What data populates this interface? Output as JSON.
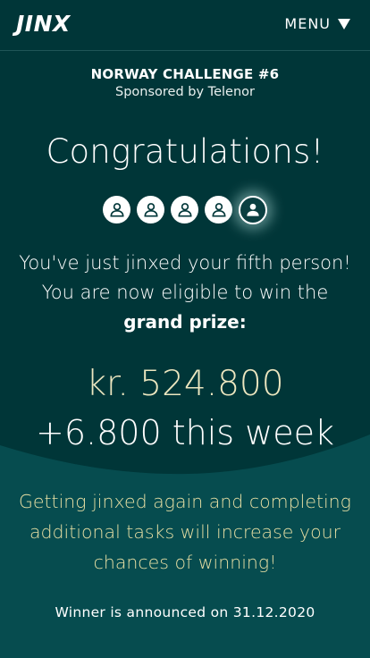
{
  "header": {
    "logo": "JINX",
    "menu_label": "MENU"
  },
  "challenge": {
    "title": "NORWAY CHALLENGE #6",
    "sponsor": "Sponsored by Telenor"
  },
  "congrats": "Congratulations!",
  "persons": {
    "jinxed_count": 5,
    "icon": "person-icon"
  },
  "message": {
    "line1": "You've just jinxed your fifth person!",
    "line2": "You are now eligible to win the",
    "line3": "grand prize:"
  },
  "prize": {
    "amount": "kr. 524.800",
    "weekly": "+6.800 this week"
  },
  "info": {
    "line1": "Getting jinxed again and completing",
    "line2": "additional tasks will increase your",
    "line3": "chances of winning!"
  },
  "winner": "Winner is announced on 31.12.2020",
  "colors": {
    "background": "#003638",
    "lower_panel": "#064c4f",
    "prize_text": "#ede7c0",
    "info_text": "#e7dfa4"
  }
}
